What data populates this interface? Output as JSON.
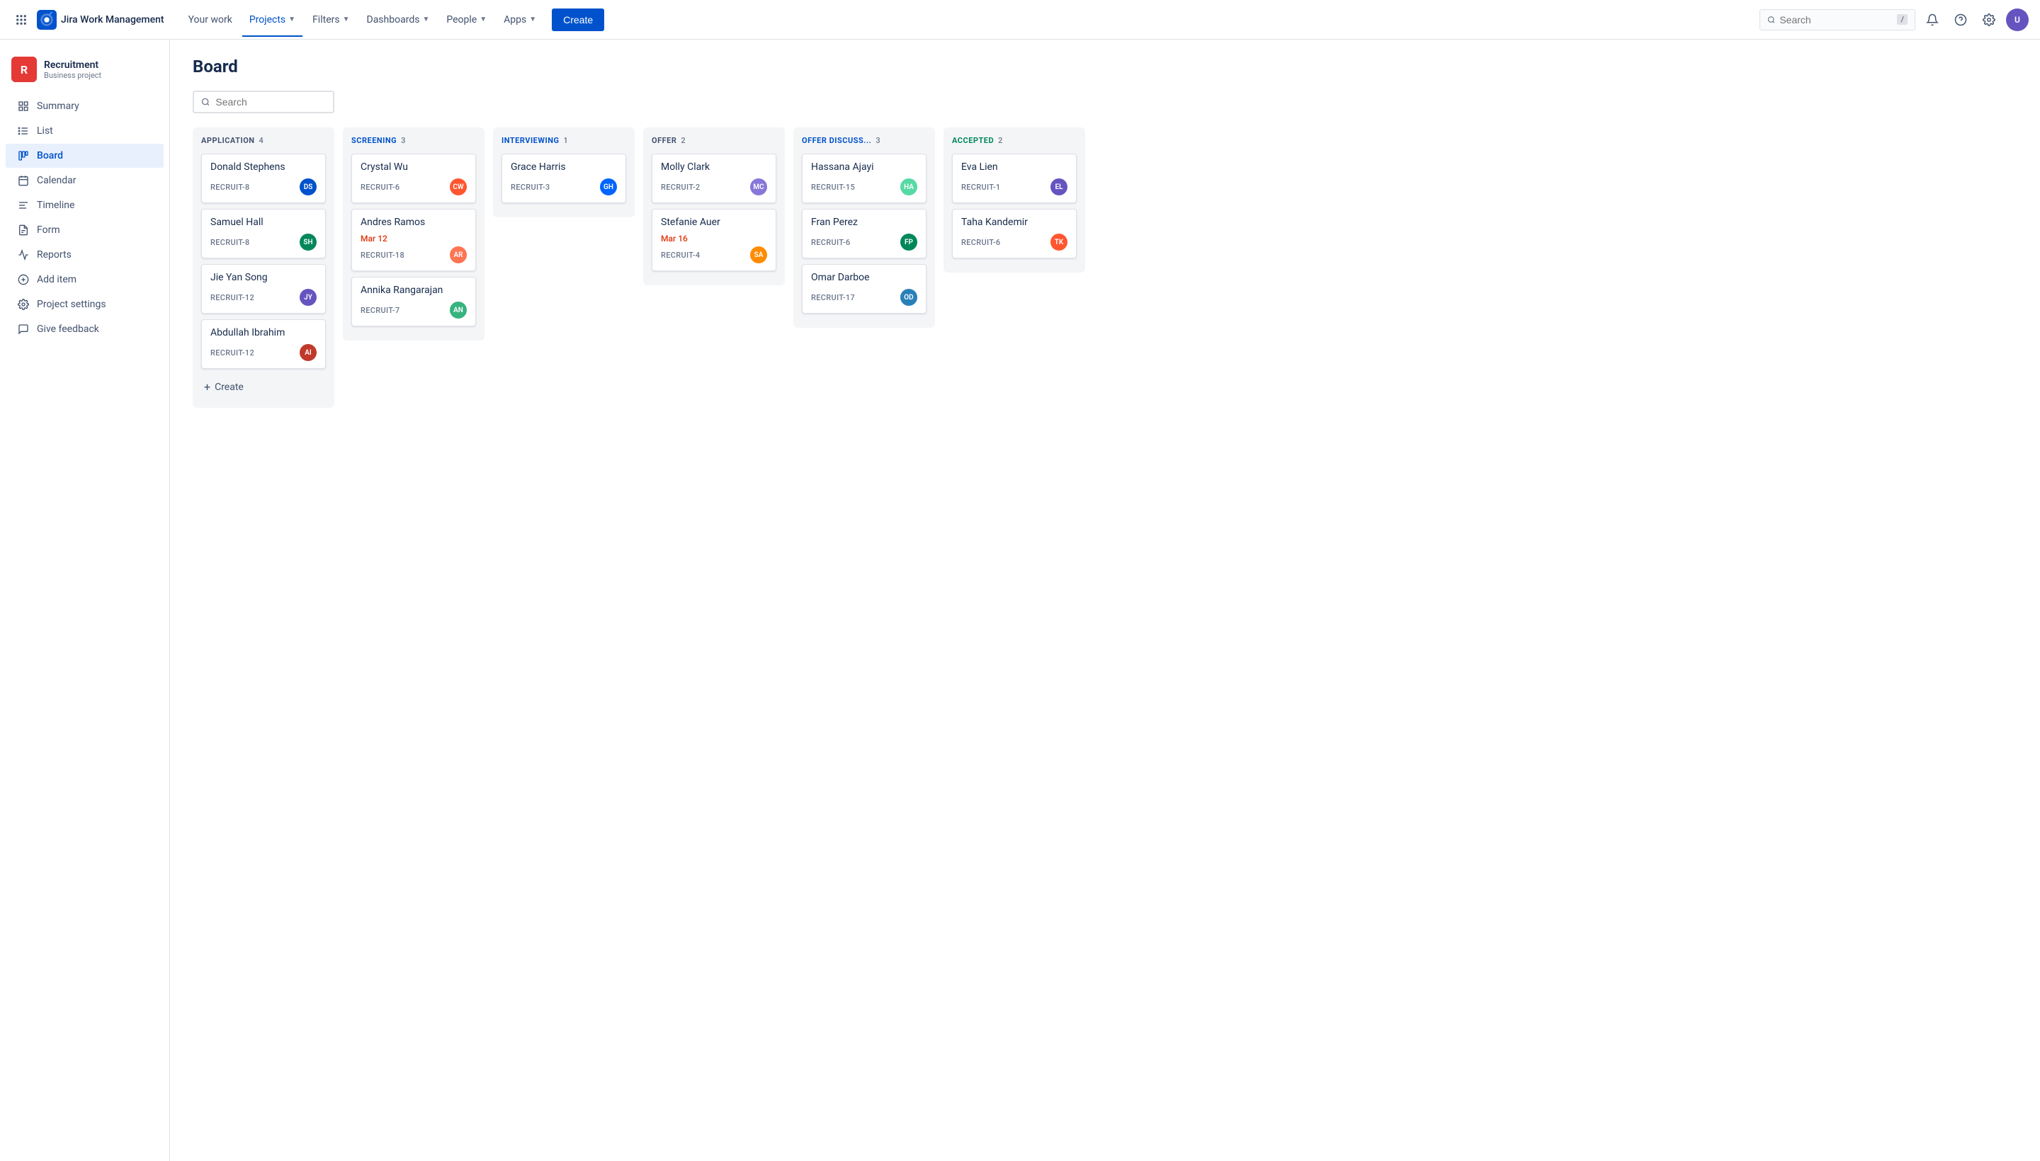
{
  "topnav": {
    "logo_text": "Jira Work Management",
    "nav_items": [
      {
        "id": "your-work",
        "label": "Your work"
      },
      {
        "id": "projects",
        "label": "Projects",
        "active": true,
        "has_dropdown": true
      },
      {
        "id": "filters",
        "label": "Filters",
        "has_dropdown": true
      },
      {
        "id": "dashboards",
        "label": "Dashboards",
        "has_dropdown": true
      },
      {
        "id": "people",
        "label": "People",
        "has_dropdown": true
      },
      {
        "id": "apps",
        "label": "Apps",
        "has_dropdown": true
      }
    ],
    "create_label": "Create",
    "search_placeholder": "Search",
    "search_shortcut": "/"
  },
  "sidebar": {
    "project_name": "Recruitment",
    "project_type": "Business project",
    "nav_items": [
      {
        "id": "summary",
        "label": "Summary",
        "icon": "summary"
      },
      {
        "id": "list",
        "label": "List",
        "icon": "list"
      },
      {
        "id": "board",
        "label": "Board",
        "icon": "board",
        "active": true
      },
      {
        "id": "calendar",
        "label": "Calendar",
        "icon": "calendar"
      },
      {
        "id": "timeline",
        "label": "Timeline",
        "icon": "timeline"
      },
      {
        "id": "form",
        "label": "Form",
        "icon": "form"
      },
      {
        "id": "reports",
        "label": "Reports",
        "icon": "reports"
      },
      {
        "id": "add-item",
        "label": "Add item",
        "icon": "add"
      },
      {
        "id": "project-settings",
        "label": "Project settings",
        "icon": "settings"
      },
      {
        "id": "give-feedback",
        "label": "Give feedback",
        "icon": "feedback"
      }
    ]
  },
  "page": {
    "title": "Board"
  },
  "board": {
    "search_placeholder": "Search",
    "columns": [
      {
        "id": "application",
        "title": "APPLICATION",
        "count": 4,
        "color_class": "col-application",
        "cards": [
          {
            "name": "Donald Stephens",
            "id": "RECRUIT-8",
            "avatar_initials": "DS",
            "avatar_class": "av-1"
          },
          {
            "name": "Samuel Hall",
            "id": "RECRUIT-8",
            "avatar_initials": "SH",
            "avatar_class": "av-2"
          },
          {
            "name": "Jie Yan Song",
            "id": "RECRUIT-12",
            "avatar_initials": "JY",
            "avatar_class": "av-3"
          },
          {
            "name": "Abdullah Ibrahim",
            "id": "RECRUIT-12",
            "avatar_initials": "AI",
            "avatar_class": "av-11"
          }
        ],
        "has_create": true
      },
      {
        "id": "screening",
        "title": "SCREENING",
        "count": 3,
        "color_class": "col-screening",
        "cards": [
          {
            "name": "Crystal Wu",
            "id": "RECRUIT-6",
            "avatar_initials": "CW",
            "avatar_class": "av-4"
          },
          {
            "name": "Andres Ramos",
            "id": "RECRUIT-18",
            "avatar_initials": "AR",
            "avatar_class": "av-5",
            "date": "Mar 12",
            "date_red": true
          },
          {
            "name": "Annika Rangarajan",
            "id": "RECRUIT-7",
            "avatar_initials": "AN",
            "avatar_class": "av-6"
          }
        ]
      },
      {
        "id": "interviewing",
        "title": "INTERVIEWING",
        "count": 1,
        "color_class": "col-interviewing",
        "cards": [
          {
            "name": "Grace Harris",
            "id": "RECRUIT-3",
            "avatar_initials": "GH",
            "avatar_class": "av-7"
          }
        ]
      },
      {
        "id": "offer",
        "title": "OFFER",
        "count": 2,
        "color_class": "col-offer",
        "cards": [
          {
            "name": "Molly Clark",
            "id": "RECRUIT-2",
            "avatar_initials": "MC",
            "avatar_class": "av-8"
          },
          {
            "name": "Stefanie Auer",
            "id": "RECRUIT-4",
            "avatar_initials": "SA",
            "avatar_class": "av-9",
            "date": "Mar 16",
            "date_red": true
          }
        ]
      },
      {
        "id": "offer-discuss",
        "title": "OFFER DISCUSS...",
        "count": 3,
        "color_class": "col-offer-discuss",
        "cards": [
          {
            "name": "Hassana Ajayi",
            "id": "RECRUIT-15",
            "avatar_initials": "HA",
            "avatar_class": "av-10"
          },
          {
            "name": "Fran Perez",
            "id": "RECRUIT-6",
            "avatar_initials": "FP",
            "avatar_class": "av-2"
          },
          {
            "name": "Omar Darboe",
            "id": "RECRUIT-17",
            "avatar_initials": "OD",
            "avatar_class": "av-12"
          }
        ]
      },
      {
        "id": "accepted",
        "title": "ACCEPTED",
        "count": 2,
        "color_class": "col-accepted",
        "cards": [
          {
            "name": "Eva Lien",
            "id": "RECRUIT-1",
            "avatar_initials": "EL",
            "avatar_class": "av-3"
          },
          {
            "name": "Taha Kandemir",
            "id": "RECRUIT-6",
            "avatar_initials": "TK",
            "avatar_class": "av-4"
          }
        ]
      }
    ],
    "create_label": "Create"
  }
}
